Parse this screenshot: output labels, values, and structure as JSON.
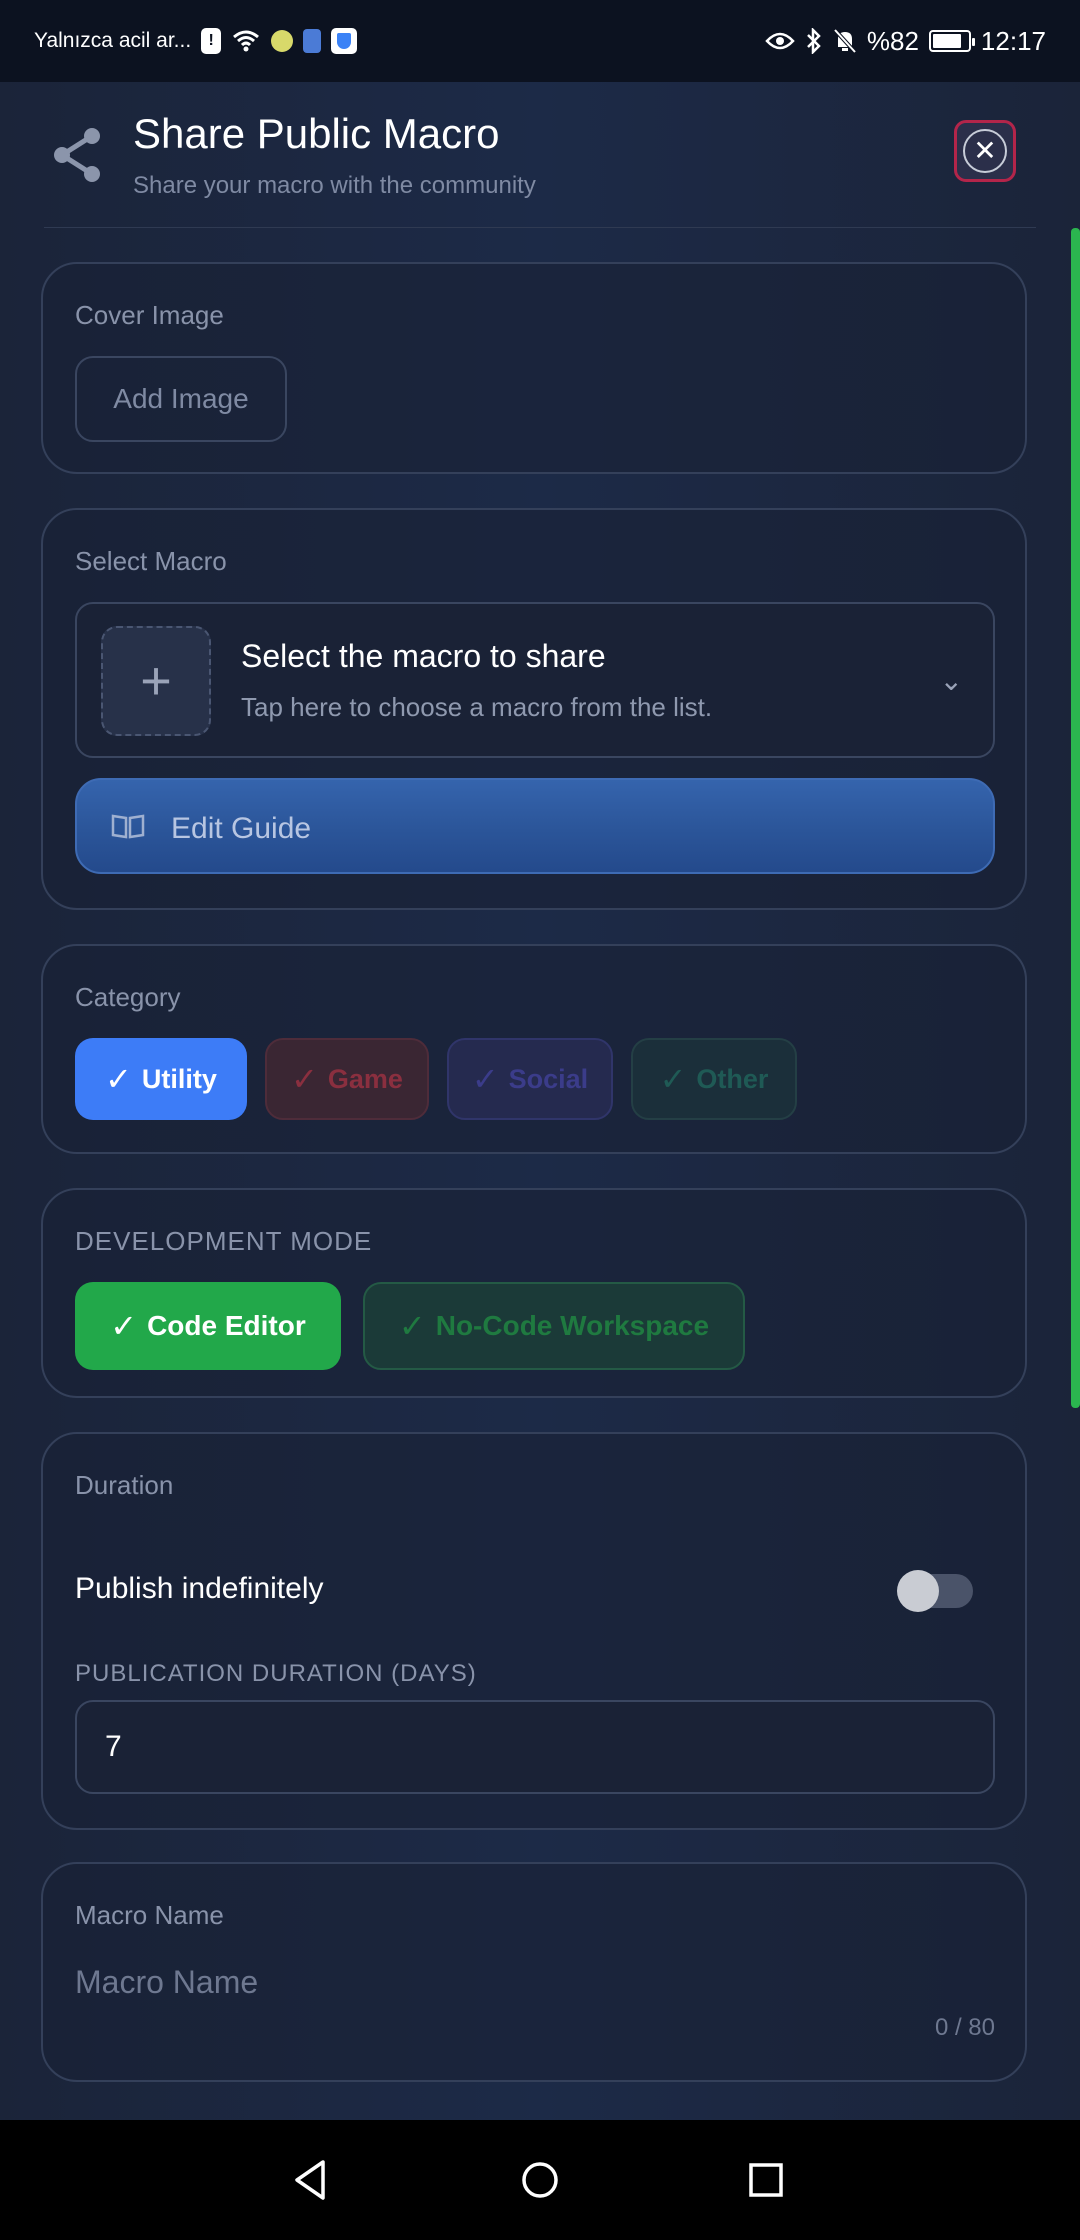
{
  "status_bar": {
    "carrier_text": "Yalnızca acil ar...",
    "battery_text": "%82",
    "battery_level": 0.82,
    "time": "12:17",
    "icons": [
      "alert-icon",
      "wifi-icon",
      "android-app-icon",
      "battery-saver-icon",
      "shield-icon",
      "eye-icon",
      "bluetooth-icon",
      "mute-bell-icon",
      "battery-icon"
    ]
  },
  "header": {
    "title": "Share Public Macro",
    "subtitle": "Share your macro with the community",
    "close_label": "✕"
  },
  "cover_image": {
    "label": "Cover Image",
    "add_button": "Add Image"
  },
  "select_macro": {
    "label": "Select Macro",
    "placeholder_title": "Select the macro to share",
    "placeholder_sub": "Tap here to choose a macro from the list.",
    "plus": "+",
    "chevron": "⌄",
    "edit_guide": "Edit Guide"
  },
  "category": {
    "label": "Category",
    "options": [
      {
        "label": "Utility",
        "selected": true,
        "color": "#3d7cf7"
      },
      {
        "label": "Game",
        "selected": false,
        "color": "#8a2f3f"
      },
      {
        "label": "Social",
        "selected": false,
        "color": "#3b3c8a"
      },
      {
        "label": "Other",
        "selected": false,
        "color": "#1f5a55"
      }
    ],
    "tick": "✓"
  },
  "development_mode": {
    "label": "DEVELOPMENT MODE",
    "options": [
      {
        "label": "Code Editor",
        "selected": true,
        "color": "#22a84a"
      },
      {
        "label": "No-Code Workspace",
        "selected": false,
        "color": "#1f7a40"
      }
    ]
  },
  "duration": {
    "label": "Duration",
    "toggle_label": "Publish indefinitely",
    "toggle_on": false,
    "days_label": "PUBLICATION DURATION (DAYS)",
    "days_value": "7"
  },
  "macro_name": {
    "label": "Macro Name",
    "placeholder": "Macro Name",
    "counter": "0 / 80"
  },
  "nav": {
    "icons": [
      "back-icon",
      "home-icon",
      "recents-icon"
    ]
  }
}
